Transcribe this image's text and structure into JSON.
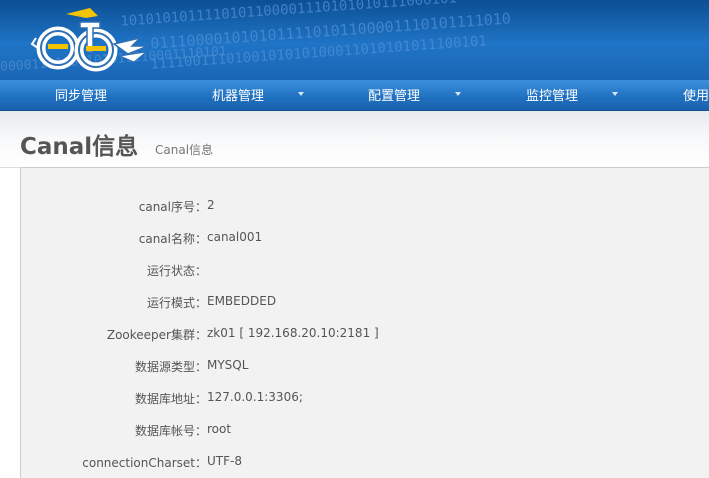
{
  "banner": {
    "binary_lines": [
      "1010101011110101100001110101010111000101",
      "0111000010101011110101100001110101111010",
      "00001111001101011110001110101",
      "1111001110100101010100011010101011100101"
    ]
  },
  "nav": {
    "items": [
      {
        "label": "同步管理",
        "has_dropdown": false
      },
      {
        "label": "机器管理",
        "has_dropdown": true
      },
      {
        "label": "配置管理",
        "has_dropdown": true
      },
      {
        "label": "监控管理",
        "has_dropdown": true
      },
      {
        "label": "使用",
        "has_dropdown": false
      }
    ]
  },
  "page": {
    "title": "Canal信息",
    "subtitle": "Canal信息"
  },
  "details": [
    {
      "label": "canal序号：",
      "value": "2"
    },
    {
      "label": "canal名称：",
      "value": "canal001"
    },
    {
      "label": "运行状态：",
      "value": ""
    },
    {
      "label": "运行模式：",
      "value": "EMBEDDED"
    },
    {
      "label": "Zookeeper集群：",
      "value": "zk01 [ 192.168.20.10:2181 ]"
    },
    {
      "label": "数据源类型：",
      "value": "MYSQL"
    },
    {
      "label": "数据库地址：",
      "value": "127.0.0.1:3306;"
    },
    {
      "label": "数据库帐号：",
      "value": "root"
    },
    {
      "label": "connectionCharset：",
      "value": "UTF-8"
    }
  ],
  "colors": {
    "banner": "#1a66b5",
    "nav": "#1f6fbf",
    "logo_ring": "#ffffff",
    "logo_accent": "#f5c400",
    "text": "#555555"
  }
}
